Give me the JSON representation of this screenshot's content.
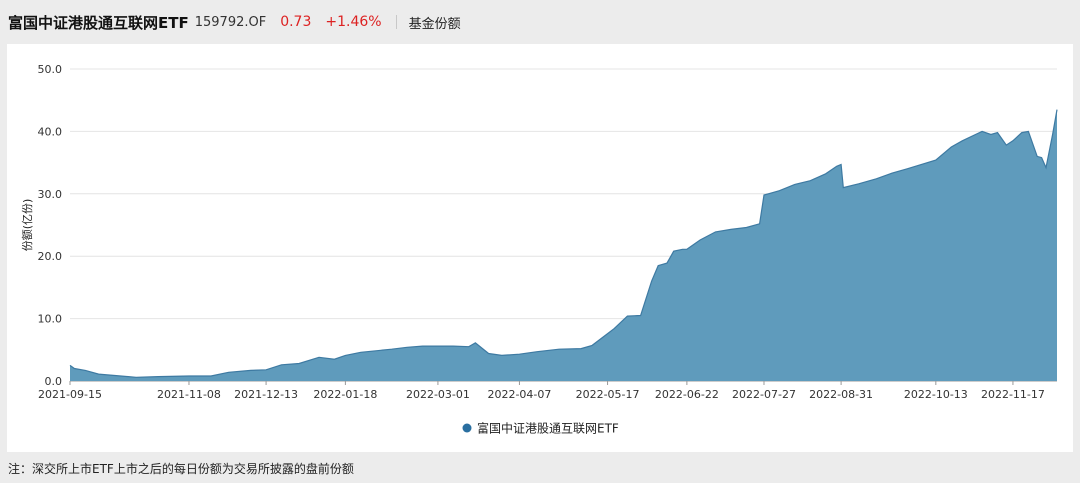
{
  "header": {
    "fund_name": "富国中证港股通互联网ETF",
    "fund_code": "159792.OF",
    "price": "0.73",
    "change_pct": "+1.46%",
    "metric": "基金份额"
  },
  "note": "注：深交所上市ETF上市之后的每日份额为交易所披露的盘前份额",
  "colors": {
    "area": "#5f9bbc",
    "line": "#3e7aa2",
    "header_red": "#dd2222"
  },
  "chart_data": {
    "type": "area",
    "ylabel": "份额(亿份)",
    "ylim": [
      0,
      50
    ],
    "yticks": [
      "0.0",
      "10.0",
      "20.0",
      "30.0",
      "40.0",
      "50.0"
    ],
    "xtick_labels": [
      "2021-09-15",
      "2021-11-08",
      "2021-12-13",
      "2022-01-18",
      "2022-03-01",
      "2022-04-07",
      "2022-05-17",
      "2022-06-22",
      "2022-07-27",
      "2022-08-31",
      "2022-10-13",
      "2022-11-17"
    ],
    "grid": "horizontal",
    "legend_position": "bottom",
    "series": [
      {
        "name": "富国中证港股通互联网ETF",
        "x": [
          "2021-09-15",
          "2021-09-17",
          "2021-09-22",
          "2021-09-28",
          "2021-10-08",
          "2021-10-15",
          "2021-10-25",
          "2021-11-08",
          "2021-11-18",
          "2021-11-26",
          "2021-12-06",
          "2021-12-13",
          "2021-12-20",
          "2021-12-28",
          "2022-01-06",
          "2022-01-13",
          "2022-01-18",
          "2022-01-25",
          "2022-02-08",
          "2022-02-15",
          "2022-02-22",
          "2022-03-01",
          "2022-03-08",
          "2022-03-15",
          "2022-03-18",
          "2022-03-24",
          "2022-03-30",
          "2022-04-07",
          "2022-04-15",
          "2022-04-25",
          "2022-05-05",
          "2022-05-10",
          "2022-05-17",
          "2022-05-20",
          "2022-05-26",
          "2022-06-01",
          "2022-06-06",
          "2022-06-09",
          "2022-06-13",
          "2022-06-16",
          "2022-06-20",
          "2022-06-22",
          "2022-06-28",
          "2022-07-05",
          "2022-07-12",
          "2022-07-19",
          "2022-07-25",
          "2022-07-27",
          "2022-07-29",
          "2022-08-03",
          "2022-08-10",
          "2022-08-17",
          "2022-08-24",
          "2022-08-29",
          "2022-08-31",
          "2022-09-01",
          "2022-09-08",
          "2022-09-16",
          "2022-09-23",
          "2022-09-30",
          "2022-10-13",
          "2022-10-20",
          "2022-10-25",
          "2022-10-31",
          "2022-11-03",
          "2022-11-07",
          "2022-11-10",
          "2022-11-14",
          "2022-11-17",
          "2022-11-21",
          "2022-11-24",
          "2022-11-28",
          "2022-11-30",
          "2022-12-02",
          "2022-12-05",
          "2022-12-07"
        ],
        "values": [
          2.5,
          2.0,
          1.7,
          1.1,
          0.8,
          0.6,
          0.7,
          0.8,
          0.8,
          1.4,
          1.7,
          1.8,
          2.6,
          2.8,
          3.8,
          3.5,
          4.1,
          4.6,
          5.1,
          5.4,
          5.6,
          5.6,
          5.6,
          5.5,
          6.1,
          4.4,
          4.1,
          4.3,
          4.7,
          5.1,
          5.2,
          5.7,
          7.6,
          8.4,
          10.4,
          10.5,
          16.0,
          18.5,
          18.9,
          20.8,
          21.1,
          21.1,
          22.6,
          23.9,
          24.3,
          24.6,
          25.2,
          29.8,
          30.0,
          30.5,
          31.5,
          32.1,
          33.2,
          34.4,
          34.7,
          31.0,
          31.6,
          32.4,
          33.3,
          34.0,
          35.4,
          37.5,
          38.5,
          39.5,
          40.0,
          39.5,
          39.8,
          37.8,
          38.5,
          39.8,
          40.0,
          36.0,
          35.8,
          34.2,
          39.5,
          43.5
        ]
      }
    ]
  }
}
